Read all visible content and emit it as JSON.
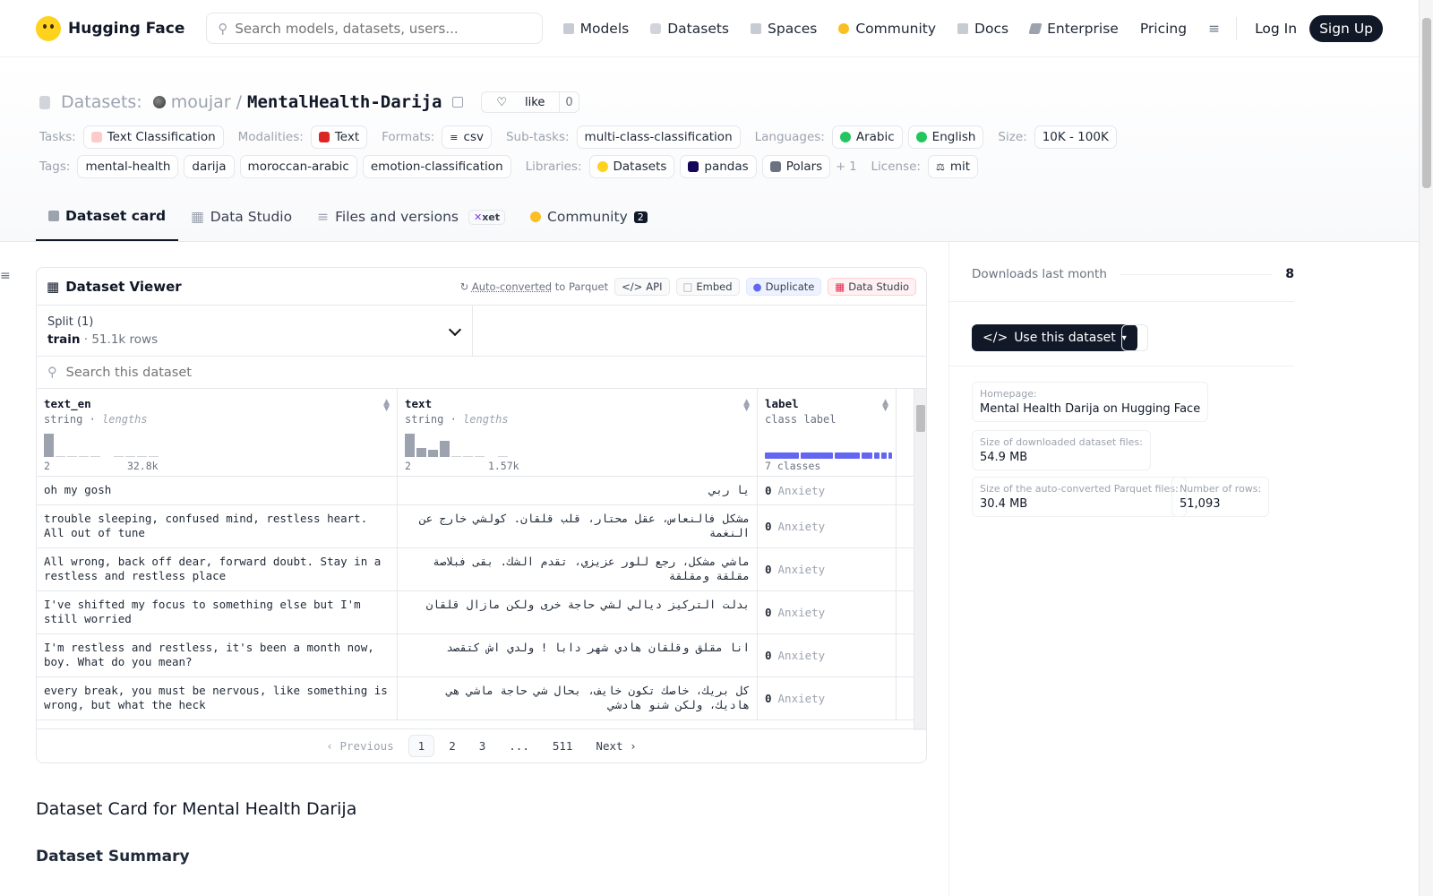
{
  "nav": {
    "brand": "Hugging Face",
    "search_placeholder": "Search models, datasets, users...",
    "links": [
      "Models",
      "Datasets",
      "Spaces",
      "Community",
      "Docs",
      "Enterprise",
      "Pricing"
    ],
    "login": "Log In",
    "signup": "Sign Up"
  },
  "repo": {
    "section": "Datasets:",
    "owner": "moujar",
    "sep": "/",
    "name": "MentalHealth-Darija",
    "like_label": "like",
    "like_count": "0"
  },
  "tags_row1": {
    "tasks_label": "Tasks:",
    "task": "Text Classification",
    "modalities_label": "Modalities:",
    "modality": "Text",
    "formats_label": "Formats:",
    "format": "csv",
    "subtasks_label": "Sub-tasks:",
    "subtask": "multi-class-classification",
    "languages_label": "Languages:",
    "lang1": "Arabic",
    "lang2": "English",
    "size_label": "Size:",
    "size": "10K - 100K"
  },
  "tags_row2": {
    "tags_label": "Tags:",
    "tags": [
      "mental-health",
      "darija",
      "moroccan-arabic",
      "emotion-classification"
    ],
    "libraries_label": "Libraries:",
    "libs": [
      "Datasets",
      "pandas",
      "Polars"
    ],
    "more": "+ 1",
    "license_label": "License:",
    "license": "mit"
  },
  "tabs": {
    "card": "Dataset card",
    "studio": "Data Studio",
    "files": "Files and versions",
    "xet": "xet",
    "community": "Community",
    "community_count": "2"
  },
  "viewer": {
    "title": "Dataset Viewer",
    "autoconv": "Auto-converted",
    "autoconv_suffix": "to Parquet",
    "api": "API",
    "embed": "Embed",
    "duplicate": "Duplicate",
    "studio": "Data Studio",
    "split_label": "Split (1)",
    "split_name": "train",
    "split_rows": "51.1k rows",
    "search_placeholder": "Search this dataset",
    "columns": [
      {
        "name": "text_en",
        "dtype": "string",
        "stat": "lengths",
        "min": "2",
        "max": "32.8k"
      },
      {
        "name": "text",
        "dtype": "string",
        "stat": "lengths",
        "min": "2",
        "max": "1.57k"
      },
      {
        "name": "label",
        "dtype": "class label",
        "classes": "7 classes"
      }
    ],
    "rows": [
      {
        "en": "oh my gosh",
        "ar": "يا ربي",
        "label": "0",
        "cls": "Anxiety"
      },
      {
        "en": "trouble sleeping, confused mind, restless heart. All out of tune",
        "ar": "مشكل فالنعاس، عقل محتار، قلب قلقان. كولشي خارج عن النغمة",
        "label": "0",
        "cls": "Anxiety"
      },
      {
        "en": "All wrong, back off dear, forward doubt. Stay in a restless and restless place",
        "ar": "ماشي مشكل، رجع للور عزيزي، تقدم الشك. بقى فبلاصة مقلقة ومقلقة",
        "label": "0",
        "cls": "Anxiety"
      },
      {
        "en": "I've shifted my focus to something else but I'm still worried",
        "ar": "بدلت التركيز ديالي لشي حاجة خرى ولكن مازال قلقان",
        "label": "0",
        "cls": "Anxiety"
      },
      {
        "en": "I'm restless and restless, it's been a month now, boy. What do you mean?",
        "ar": "انا مقلق وقلقان هادي شهر دابا ! ولدي اش كتقصد",
        "label": "0",
        "cls": "Anxiety"
      },
      {
        "en": "every break, you must be nervous, like something is wrong, but what the heck",
        "ar": "كل بريك، خاصك تكون خايف، بحال شي حاجة ماشي هي هاديك، ولكن شنو هادشي",
        "label": "0",
        "cls": "Anxiety"
      }
    ],
    "pager": {
      "prev": "Previous",
      "pages": [
        "1",
        "2",
        "3",
        "...",
        "511"
      ],
      "next": "Next"
    }
  },
  "card": {
    "title": "Dataset Card for Mental Health Darija",
    "summary": "Dataset Summary"
  },
  "sidebar": {
    "downloads_label": "Downloads last month",
    "downloads": "8",
    "use_button": "Use this dataset",
    "homepage_k": "Homepage:",
    "homepage_v": "Mental Health Darija on Hugging Face",
    "dlsize_k": "Size of downloaded dataset files:",
    "dlsize_v": "54.9 MB",
    "pqsize_k": "Size of the auto-converted Parquet files:",
    "pqsize_v": "30.4 MB",
    "rows_k": "Number of rows:",
    "rows_v": "51,093"
  },
  "colors": {
    "accent": "#111827",
    "label_bar": "#6366f1",
    "brand": "#ffd21e"
  }
}
